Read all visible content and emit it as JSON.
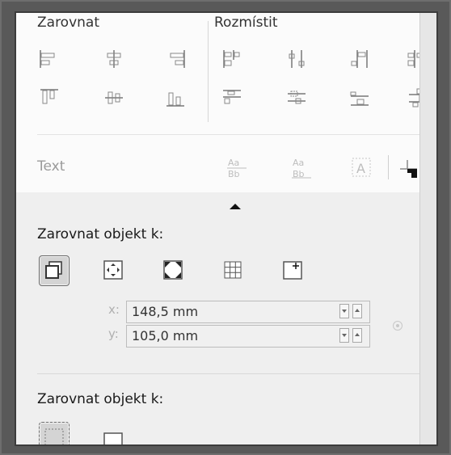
{
  "align": {
    "group_label": "Zarovnat",
    "row1": [
      "align-left-icon",
      "align-center-horizontal-icon",
      "align-right-icon"
    ],
    "row2": [
      "align-top-icon",
      "align-center-vertical-icon",
      "align-bottom-icon"
    ]
  },
  "distribute": {
    "group_label": "Rozmístit",
    "row1": [
      "distribute-left-icon",
      "distribute-center-icon",
      "distribute-spacing-horizontal-icon",
      "distribute-right-icon"
    ],
    "row2": [
      "distribute-top-icon",
      "distribute-middle-icon",
      "distribute-bottom-icon",
      "distribute-spacing-vertical-icon"
    ]
  },
  "text_section": {
    "label": "Text",
    "icons": [
      "text-first-baseline-icon",
      "text-last-baseline-icon",
      "text-bounding-box-icon",
      "outline-corner-icon"
    ]
  },
  "align_to": {
    "title": "Zarovnat objekt k:",
    "options": [
      {
        "icon": "active-objects-icon",
        "selected": true
      },
      {
        "icon": "page-edge-icon",
        "selected": false
      },
      {
        "icon": "page-center-icon",
        "selected": false
      },
      {
        "icon": "grid-icon",
        "selected": false
      },
      {
        "icon": "specified-point-icon",
        "selected": false
      }
    ],
    "x_label": "x:",
    "x_value": "148,5 mm",
    "y_label": "y:",
    "y_value": "105,0 mm"
  },
  "align_to_second": {
    "title": "Zarovnat objekt k:"
  },
  "colors": {
    "icon_gray": "#8a8a8a",
    "icon_dark": "#555555",
    "disabled": "#b5b5b5"
  }
}
